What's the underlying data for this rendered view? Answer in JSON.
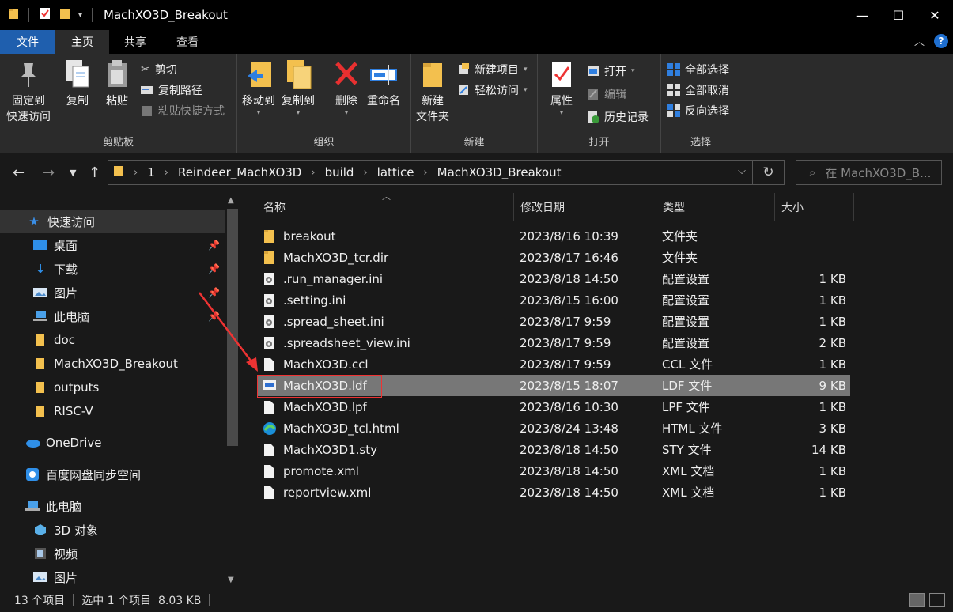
{
  "window": {
    "title": "MachXO3D_Breakout",
    "controls": {
      "minimize": "—",
      "maximize": "☐",
      "close": "✕"
    }
  },
  "ribbon_tabs": {
    "file": "文件",
    "home": "主页",
    "share": "共享",
    "view": "查看"
  },
  "ribbon": {
    "clipboard": {
      "label": "剪贴板",
      "pin_quick": "固定到\n快速访问",
      "pin_quick_line1": "固定到",
      "pin_quick_line2": "快速访问",
      "copy": "复制",
      "paste": "粘贴",
      "cut": "剪切",
      "copy_path": "复制路径",
      "paste_shortcut": "粘贴快捷方式"
    },
    "organize": {
      "label": "组织",
      "move_to": "移动到",
      "copy_to": "复制到",
      "delete": "删除",
      "rename": "重命名"
    },
    "new": {
      "label": "新建",
      "new_folder_line1": "新建",
      "new_folder_line2": "文件夹",
      "new_item": "新建项目",
      "easy_access": "轻松访问"
    },
    "open": {
      "label": "打开",
      "properties": "属性",
      "open": "打开",
      "edit": "编辑",
      "history": "历史记录"
    },
    "select": {
      "label": "选择",
      "select_all": "全部选择",
      "select_none": "全部取消",
      "invert": "反向选择"
    }
  },
  "address": {
    "crumbs": [
      "1",
      "Reindeer_MachXO3D",
      "build",
      "lattice",
      "MachXO3D_Breakout"
    ],
    "search_placeholder": "在 MachXO3D_B..."
  },
  "nav": {
    "quick_access": "快速访问",
    "items": [
      {
        "label": "桌面",
        "pinned": true
      },
      {
        "label": "下载",
        "pinned": true
      },
      {
        "label": "图片",
        "pinned": true
      },
      {
        "label": "此电脑",
        "pinned": true
      },
      {
        "label": "doc",
        "pinned": false
      },
      {
        "label": "MachXO3D_Breakout",
        "pinned": false
      },
      {
        "label": "outputs",
        "pinned": false
      },
      {
        "label": "RISC-V",
        "pinned": false
      }
    ],
    "onedrive": "OneDrive",
    "baidu": "百度网盘同步空间",
    "this_pc": "此电脑",
    "pc_items": [
      "3D 对象",
      "视频",
      "图片"
    ]
  },
  "columns": {
    "name": "名称",
    "modified": "修改日期",
    "type": "类型",
    "size": "大小"
  },
  "files": [
    {
      "name": "breakout",
      "modified": "2023/8/16 10:39",
      "type": "文件夹",
      "size": "",
      "icon": "folder-icon"
    },
    {
      "name": "MachXO3D_tcr.dir",
      "modified": "2023/8/17 16:46",
      "type": "文件夹",
      "size": "",
      "icon": "folder-icon"
    },
    {
      "name": ".run_manager.ini",
      "modified": "2023/8/18 14:50",
      "type": "配置设置",
      "size": "1 KB",
      "icon": "settings-file-icon"
    },
    {
      "name": ".setting.ini",
      "modified": "2023/8/15 16:00",
      "type": "配置设置",
      "size": "1 KB",
      "icon": "settings-file-icon"
    },
    {
      "name": ".spread_sheet.ini",
      "modified": "2023/8/17 9:59",
      "type": "配置设置",
      "size": "1 KB",
      "icon": "settings-file-icon"
    },
    {
      "name": ".spreadsheet_view.ini",
      "modified": "2023/8/17 9:59",
      "type": "配置设置",
      "size": "2 KB",
      "icon": "settings-file-icon"
    },
    {
      "name": "MachXO3D.ccl",
      "modified": "2023/8/17 9:59",
      "type": "CCL 文件",
      "size": "1 KB",
      "icon": "file-icon"
    },
    {
      "name": "MachXO3D.ldf",
      "modified": "2023/8/15 18:07",
      "type": "LDF 文件",
      "size": "9 KB",
      "icon": "ldf-file-icon",
      "selected": true
    },
    {
      "name": "MachXO3D.lpf",
      "modified": "2023/8/16 10:30",
      "type": "LPF 文件",
      "size": "1 KB",
      "icon": "file-icon"
    },
    {
      "name": "MachXO3D_tcl.html",
      "modified": "2023/8/24 13:48",
      "type": "HTML 文件",
      "size": "3 KB",
      "icon": "edge-icon"
    },
    {
      "name": "MachXO3D1.sty",
      "modified": "2023/8/18 14:50",
      "type": "STY 文件",
      "size": "14 KB",
      "icon": "file-icon"
    },
    {
      "name": "promote.xml",
      "modified": "2023/8/18 14:50",
      "type": "XML 文档",
      "size": "1 KB",
      "icon": "file-icon"
    },
    {
      "name": "reportview.xml",
      "modified": "2023/8/18 14:50",
      "type": "XML 文档",
      "size": "1 KB",
      "icon": "file-icon"
    }
  ],
  "status": {
    "count": "13 个项目",
    "selection": "选中 1 个项目  8.03 KB"
  },
  "colors": {
    "accent": "#1f5fae",
    "folder": "#f3c04e",
    "highlight_box": "#e33333",
    "selected_row": "#777777"
  }
}
